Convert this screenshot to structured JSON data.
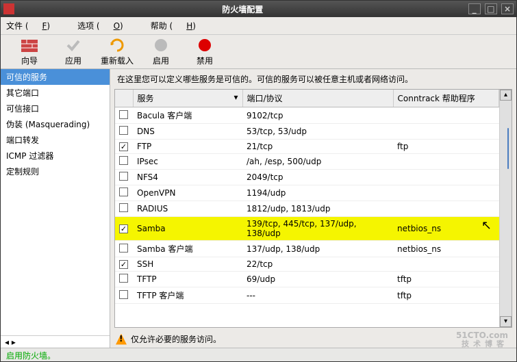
{
  "window": {
    "title": "防火墙配置"
  },
  "menu": {
    "file": "文件 (",
    "file_u": "F",
    "opt": "选项 (",
    "opt_u": "O",
    "help": "帮助 (",
    "help_u": "H",
    "close": ")"
  },
  "toolbar": {
    "wizard": "向导",
    "apply": "应用",
    "reload": "重新载入",
    "enable": "启用",
    "disable": "禁用"
  },
  "sidebar": {
    "items": [
      {
        "label": "可信的服务",
        "sel": true
      },
      {
        "label": "其它端口"
      },
      {
        "label": "可信接口"
      },
      {
        "label": "伪装 (Masquerading)"
      },
      {
        "label": "端口转发"
      },
      {
        "label": "ICMP 过滤器"
      },
      {
        "label": "定制规则"
      }
    ]
  },
  "desc": "在这里您可以定义哪些服务是可信的。可信的服务可以被任意主机或者网络访问。",
  "cols": {
    "service": "服务",
    "port": "端口/协议",
    "conntrack": "Conntrack 帮助程序"
  },
  "rows": [
    {
      "c": false,
      "s": "Bacula 客户端",
      "p": "9102/tcp",
      "h": ""
    },
    {
      "c": false,
      "s": "DNS",
      "p": "53/tcp, 53/udp",
      "h": ""
    },
    {
      "c": true,
      "s": "FTP",
      "p": "21/tcp",
      "h": "ftp"
    },
    {
      "c": false,
      "s": "IPsec",
      "p": "/ah, /esp, 500/udp",
      "h": ""
    },
    {
      "c": false,
      "s": "NFS4",
      "p": "2049/tcp",
      "h": ""
    },
    {
      "c": false,
      "s": "OpenVPN",
      "p": "1194/udp",
      "h": ""
    },
    {
      "c": false,
      "s": "RADIUS",
      "p": "1812/udp, 1813/udp",
      "h": ""
    },
    {
      "c": true,
      "s": "Samba",
      "p": "139/tcp, 445/tcp, 137/udp, 138/udp",
      "h": "netbios_ns",
      "hl": true
    },
    {
      "c": false,
      "s": "Samba 客户端",
      "p": "137/udp, 138/udp",
      "h": "netbios_ns"
    },
    {
      "c": true,
      "s": "SSH",
      "p": "22/tcp",
      "h": ""
    },
    {
      "c": false,
      "s": "TFTP",
      "p": "69/udp",
      "h": "tftp"
    },
    {
      "c": false,
      "s": "TFTP 客户端",
      "p": "---",
      "h": "tftp"
    }
  ],
  "note": "仅允许必要的服务访问。",
  "status": "启用防火墙。",
  "watermark": {
    "main": "51CTO.com",
    "sub": "技术博客"
  }
}
